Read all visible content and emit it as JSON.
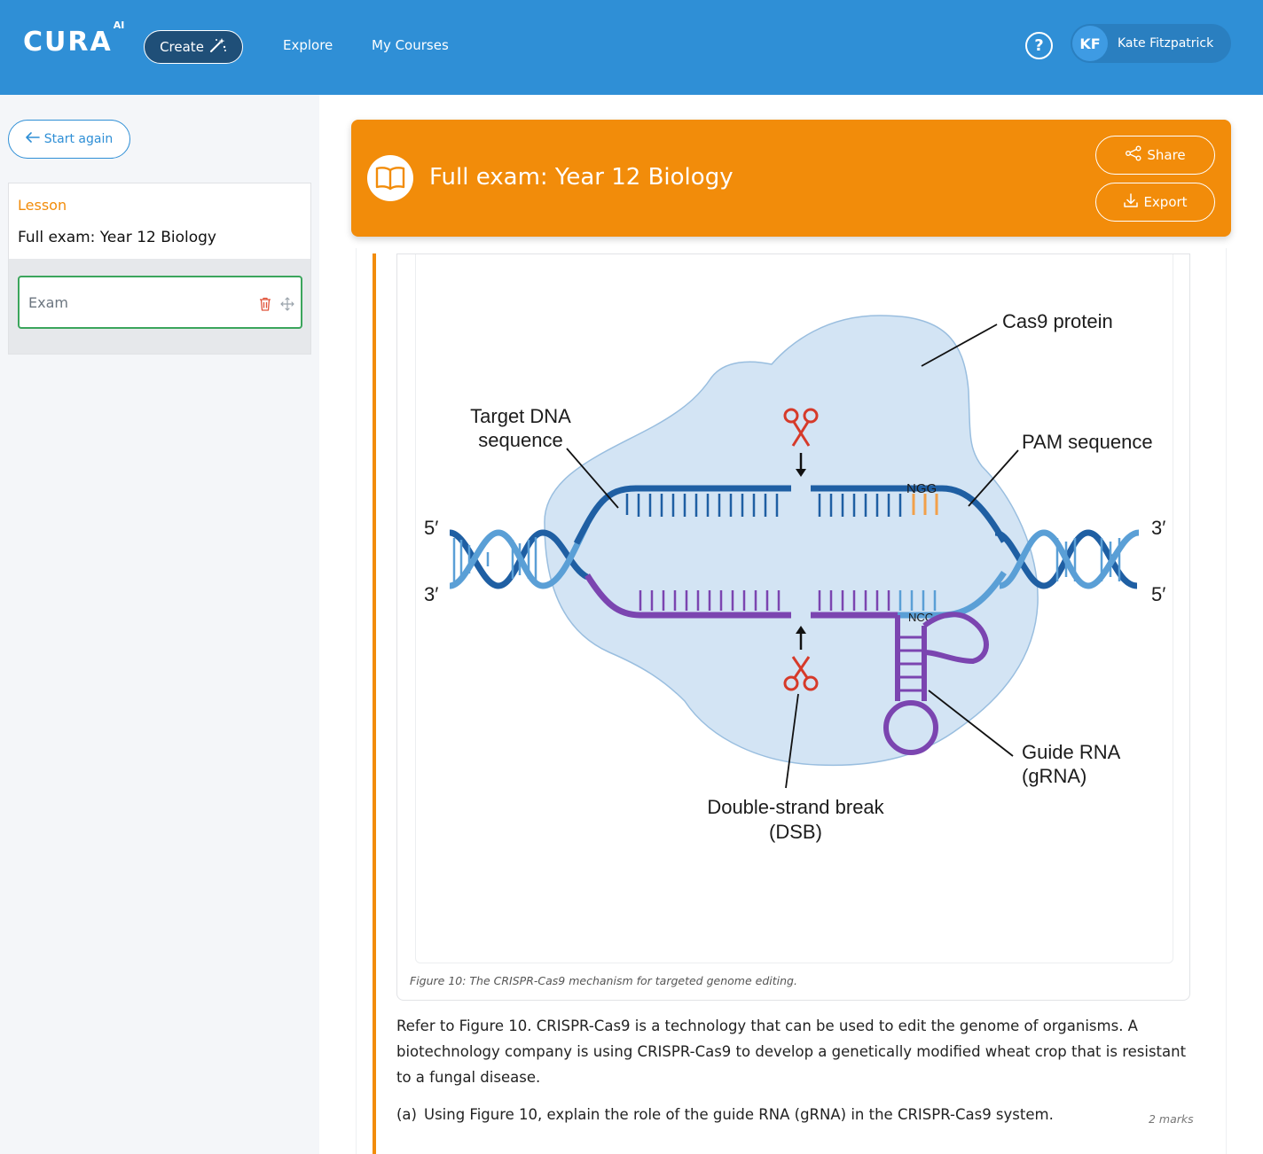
{
  "header": {
    "logo_text": "CURA",
    "logo_sup": "AI",
    "create_label": "Create",
    "nav": [
      "Explore",
      "My Courses"
    ],
    "help_symbol": "?",
    "user_initials": "KF",
    "user_name": "Kate Fitzpatrick"
  },
  "sidebar": {
    "start_again_label": "Start again",
    "lesson_label": "Lesson",
    "lesson_title": "Full exam: Year 12 Biology",
    "items": [
      {
        "label": "Exam"
      }
    ]
  },
  "banner": {
    "title": "Full exam: Year 12 Biology",
    "share_label": "Share",
    "export_label": "Export"
  },
  "figure": {
    "labels": {
      "cas9": "Cas9 protein",
      "target_line1": "Target DNA",
      "target_line2": "sequence",
      "pam": "PAM sequence",
      "grna_line1": "Guide RNA",
      "grna_line2": "(gRNA)",
      "dsb_line1": "Double-strand break",
      "dsb_line2": "(DSB)",
      "five_prime": "5′",
      "three_prime": "3′",
      "ngg": "NGG",
      "ncc": "NCC"
    },
    "colors": {
      "dna_blue": "#1f5fa3",
      "dna_light": "#5a9fd6",
      "protein_fill": "#cfe2f3",
      "grna_purple": "#7b45b0",
      "pam_orange": "#f2a04a",
      "scissors_red": "#d63a2a"
    },
    "caption": "Figure 10: The CRISPR-Cas9 mechanism for targeted genome editing."
  },
  "question": {
    "text": "Refer to Figure 10. CRISPR-Cas9 is a technology that can be used to edit the genome of organisms. A biotechnology company is using CRISPR-Cas9 to develop a genetically modified wheat crop that is resistant to a fungal disease.",
    "part_a_letter": "(a)",
    "part_a_text": "Using Figure 10, explain the role of the guide RNA (gRNA) in the CRISPR-Cas9 system.",
    "part_a_marks": "2 marks"
  },
  "icons": {
    "create": "magic-wand-icon",
    "help": "help-circle-icon",
    "back": "arrow-left-icon",
    "trash": "trash-icon",
    "move": "move-icon",
    "book": "book-icon",
    "share": "share-icon",
    "export": "download-icon"
  }
}
